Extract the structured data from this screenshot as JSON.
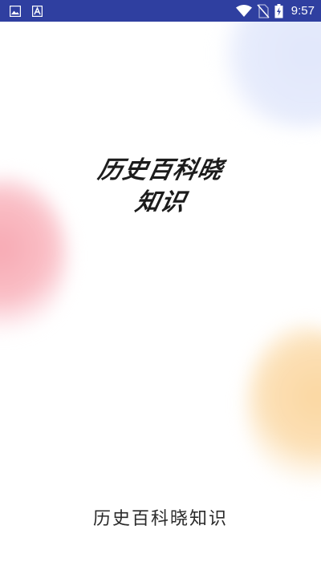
{
  "status_bar": {
    "time": "9:57",
    "background_color": "#2f3fa0",
    "left_icons": [
      "image-icon",
      "text-a-icon"
    ],
    "right_icons": [
      "wifi-icon",
      "no-sim-icon",
      "battery-charging-icon"
    ]
  },
  "splash": {
    "logo_line_1": "历史百科晓",
    "logo_line_2": "知识",
    "app_name": "历史百科晓知识"
  },
  "colors": {
    "background": "#ffffff",
    "blob_blue": "#e1e7fb",
    "blob_pink": "#f7a9b3",
    "blob_orange": "#fbd7a1",
    "text": "#1c1c1c"
  }
}
